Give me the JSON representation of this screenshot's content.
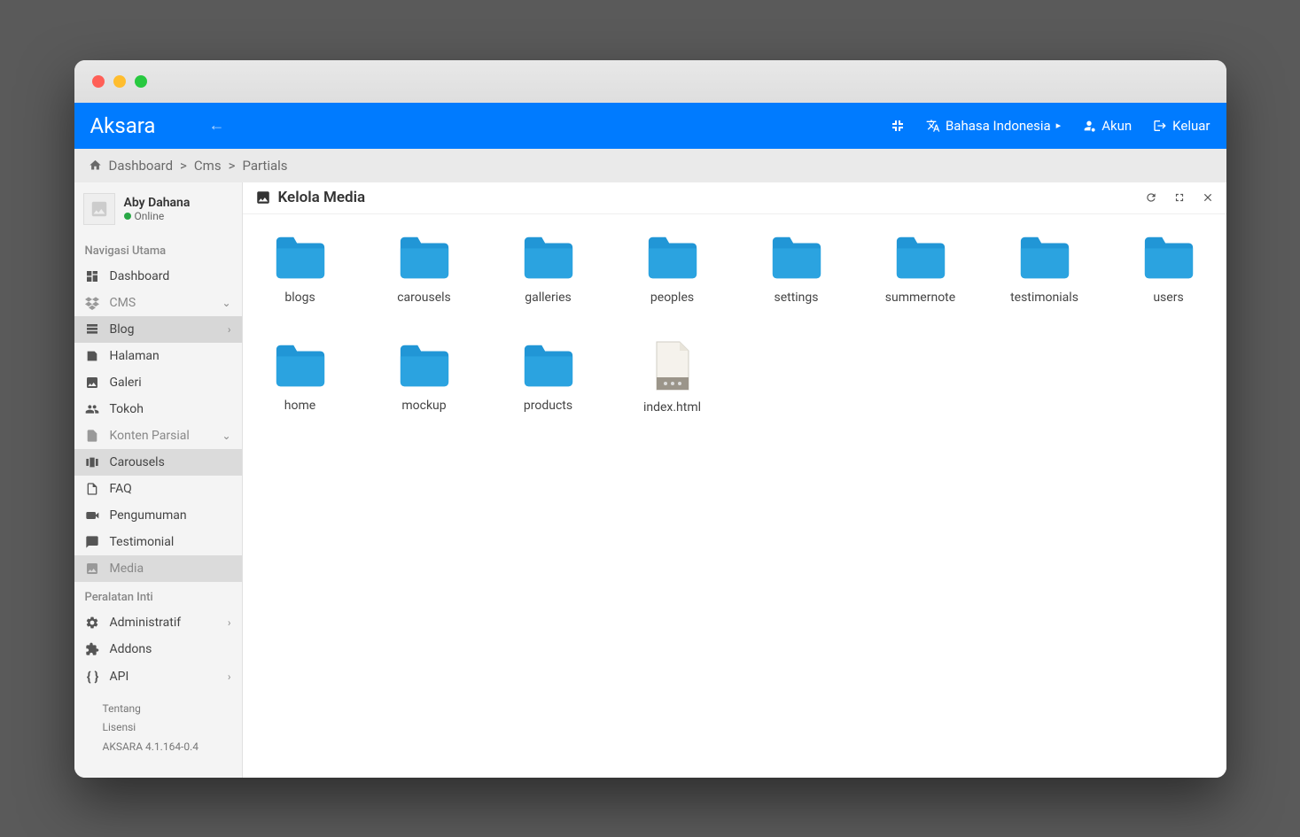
{
  "header": {
    "brand": "Aksara",
    "language": "Bahasa Indonesia",
    "account": "Akun",
    "logout": "Keluar"
  },
  "breadcrumb": {
    "root": "Dashboard",
    "mid": "Cms",
    "leaf": "Partials"
  },
  "user": {
    "name": "Aby Dahana",
    "status": "Online"
  },
  "nav": {
    "main_header": "Navigasi Utama",
    "dashboard": "Dashboard",
    "cms": "CMS",
    "blog": "Blog",
    "halaman": "Halaman",
    "galeri": "Galeri",
    "tokoh": "Tokoh",
    "konten_parsial": "Konten Parsial",
    "carousels": "Carousels",
    "faq": "FAQ",
    "pengumuman": "Pengumuman",
    "testimonial": "Testimonial",
    "media": "Media",
    "tools_header": "Peralatan Inti",
    "admin": "Administratif",
    "addons": "Addons",
    "api": "API"
  },
  "footer": {
    "about": "Tentang",
    "license": "Lisensi",
    "version": "AKSARA 4.1.164-0.4"
  },
  "content": {
    "title": "Kelola Media",
    "items": [
      {
        "type": "folder",
        "name": "blogs"
      },
      {
        "type": "folder",
        "name": "carousels"
      },
      {
        "type": "folder",
        "name": "galleries"
      },
      {
        "type": "folder",
        "name": "peoples"
      },
      {
        "type": "folder",
        "name": "settings"
      },
      {
        "type": "folder",
        "name": "summernote"
      },
      {
        "type": "folder",
        "name": "testimonials"
      },
      {
        "type": "folder",
        "name": "users"
      },
      {
        "type": "folder",
        "name": "home"
      },
      {
        "type": "folder",
        "name": "mockup"
      },
      {
        "type": "folder",
        "name": "products"
      },
      {
        "type": "file",
        "name": "index.html"
      }
    ]
  }
}
